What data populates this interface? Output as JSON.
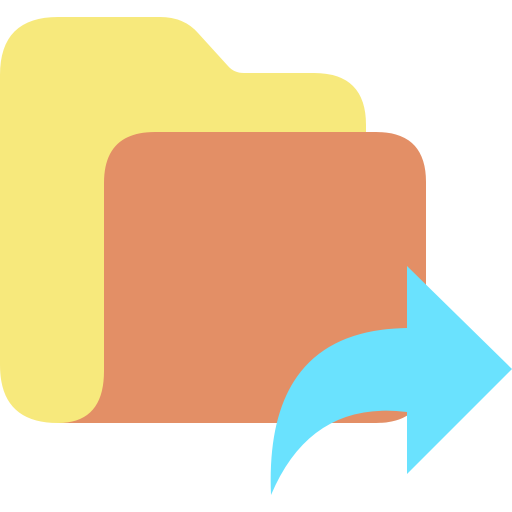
{
  "icon": {
    "name": "folder-share-icon",
    "parts": [
      "folder-back-icon",
      "folder-front-icon",
      "share-arrow-icon"
    ]
  },
  "colors": {
    "background": "#ffffff",
    "folder_back": "#F7E97C",
    "folder_front": "#E38F66",
    "arrow": "#6AE2FE"
  }
}
